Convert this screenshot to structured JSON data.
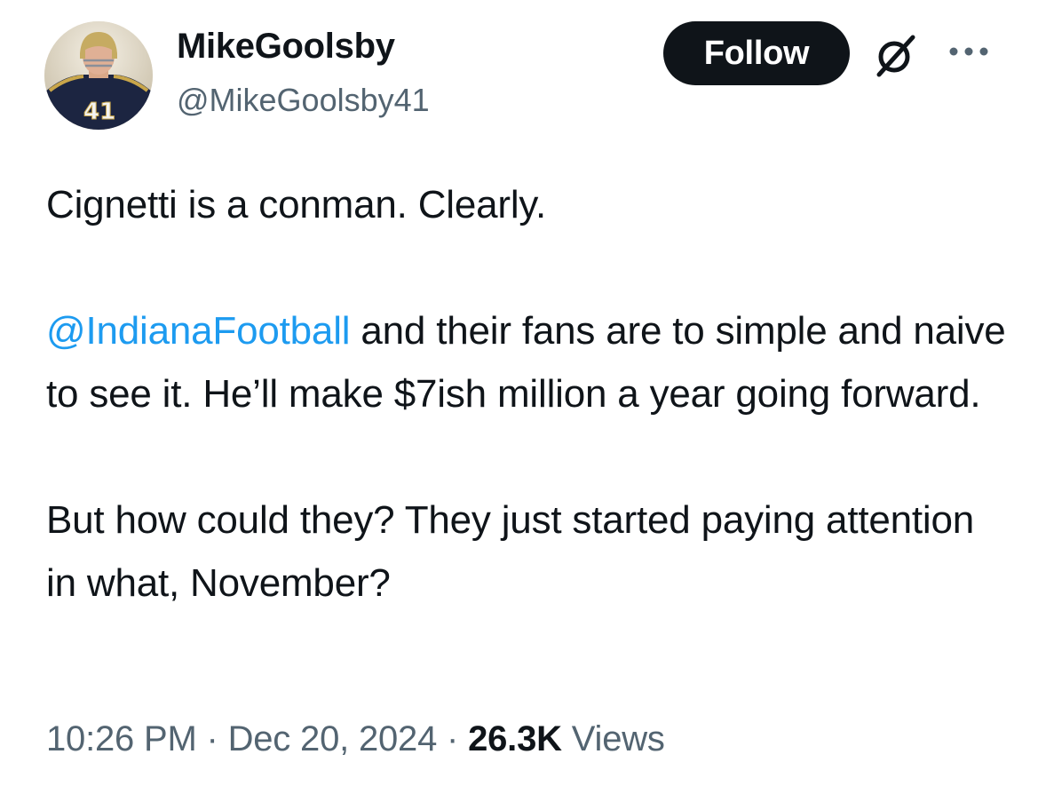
{
  "author": {
    "display_name": "MikeGoolsby",
    "handle": "@MikeGoolsby41",
    "avatar_jersey_number": "41"
  },
  "actions": {
    "follow_label": "Follow",
    "grok_icon": "grok-slash-icon",
    "more_icon": "more-dots-icon"
  },
  "tweet": {
    "line1": "Cignetti is a conman. Clearly.",
    "mention": "@IndianaFootball",
    "para2_rest": " and their fans are to simple and naive to see it. He’ll make $7ish million a year going forward.",
    "para3": "But how could they? They just started paying attention in what, November?"
  },
  "meta": {
    "time": "10:26 PM",
    "separator": " · ",
    "date": "Dec 20, 2024",
    "views_count": "26.3K",
    "views_label": " Views"
  },
  "colors": {
    "text": "#0f1419",
    "secondary": "#536471",
    "link": "#1d9bf0",
    "button_bg": "#0f1419"
  }
}
